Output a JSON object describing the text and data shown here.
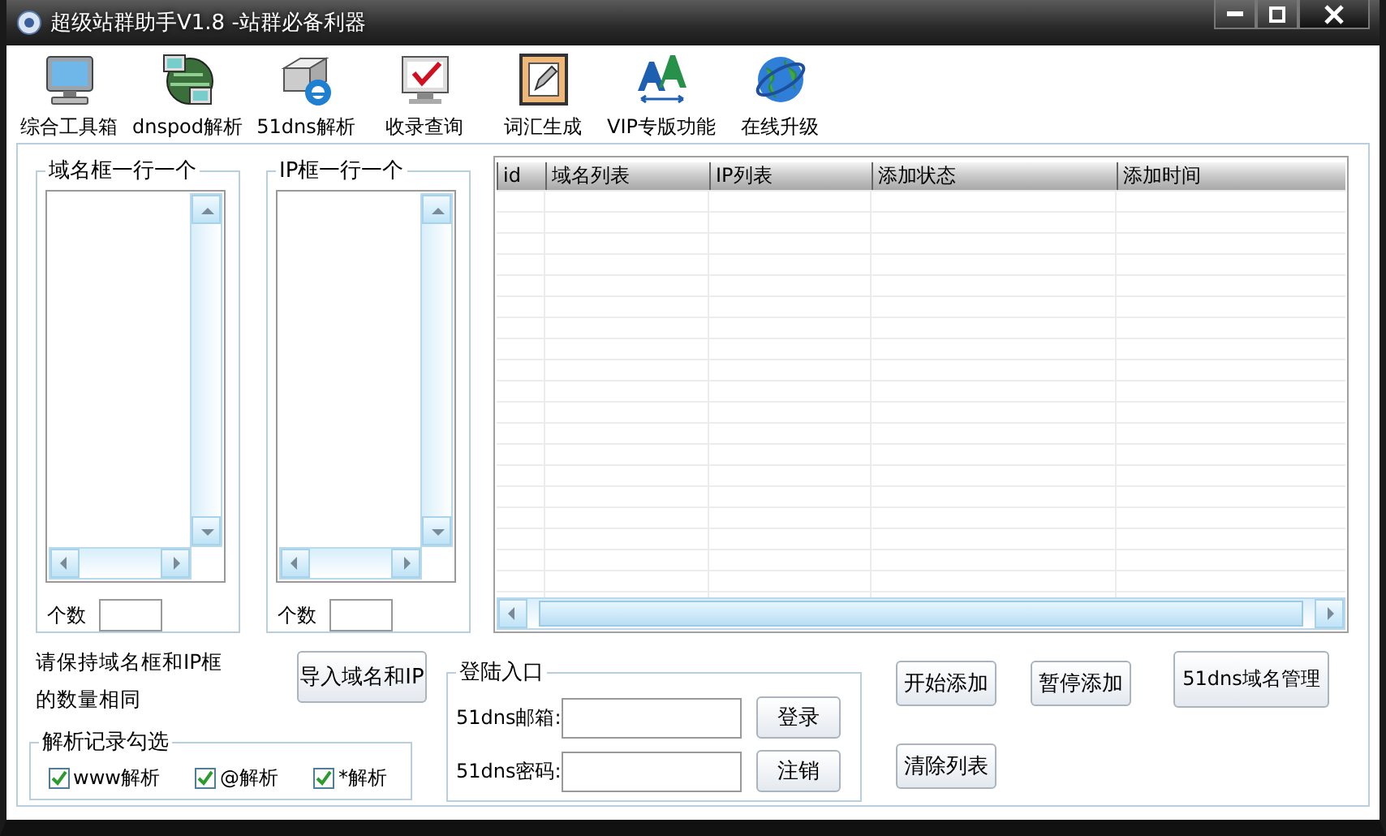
{
  "window": {
    "title": "超级站群助手V1.8 -站群必备利器"
  },
  "toolbar": [
    {
      "label": "综合工具箱",
      "kind": "monitor"
    },
    {
      "label": "dnspod解析",
      "kind": "network"
    },
    {
      "label": "51dns解析",
      "kind": "drive"
    },
    {
      "label": "收录查询",
      "kind": "check"
    },
    {
      "label": "词汇生成",
      "kind": "notepad"
    },
    {
      "label": "VIP专版功能",
      "kind": "font"
    },
    {
      "label": "在线升级",
      "kind": "globe"
    }
  ],
  "domain_box": {
    "title": "域名框一行一个",
    "count_label": "个数"
  },
  "ip_box": {
    "title": "IP框一行一个",
    "count_label": "个数"
  },
  "table": {
    "columns": [
      "id",
      "域名列表",
      "IP列表",
      "添加状态",
      "添加时间"
    ]
  },
  "note_lines": [
    "请保持域名框和IP框",
    "的数量相同"
  ],
  "import_button": "导入域名和IP",
  "records": {
    "title": "解析记录勾选",
    "options": [
      {
        "label": "www解析",
        "checked": true
      },
      {
        "label": "@解析",
        "checked": true
      },
      {
        "label": "*解析",
        "checked": true
      }
    ]
  },
  "login": {
    "title": "登陆入口",
    "fields": [
      {
        "label": "51dns邮箱:",
        "button": "登录"
      },
      {
        "label": "51dns密码:",
        "button": "注销"
      }
    ]
  },
  "actions": [
    "开始添加",
    "暂停添加",
    "51dns域名管理",
    "清除列表"
  ]
}
